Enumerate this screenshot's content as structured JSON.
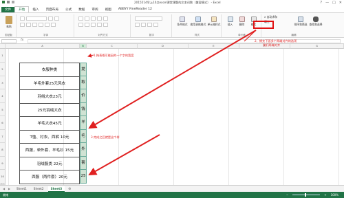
{
  "window": {
    "title": "2015514早上10点excel课堂课题的文本词数（兼容模式） - Excel",
    "controls": [
      "?",
      "—",
      "□",
      "✕"
    ]
  },
  "ribbon_tabs": [
    "文件",
    "开始",
    "插入",
    "页面布局",
    "公式",
    "数据",
    "审阅",
    "视图",
    "ABBYY FineReader 12"
  ],
  "ribbon": {
    "paste_label": "粘贴",
    "clipboard_label": "剪贴板",
    "font_label": "字体",
    "align_label": "对齐方式",
    "number_label": "数字",
    "styles_label": "样式",
    "cells_label": "单元格",
    "editing_label": "编辑",
    "cond_format": "条件格式",
    "table_format": "套用表格格式",
    "cell_styles": "单元格样式",
    "insert": "插入",
    "delete": "删除",
    "format": "格式",
    "autosum": "Σ 自动求和",
    "fill": "填充",
    "sort_filter": "排序和筛选",
    "find_select": "查找和选择"
  },
  "formula_bar": {
    "fx": "fx",
    "value": ""
  },
  "columns": [
    "A",
    "B",
    "C",
    "D",
    "E",
    "F",
    "G"
  ],
  "rows": [
    "1",
    "2",
    "3",
    "4",
    "5",
    "6",
    "7",
    "8",
    "9",
    "10",
    "11"
  ],
  "table_cells": [
    "衣服种类",
    "羊毛外套25元风衣",
    "羽绒大衣23元",
    "25元羽绒大衣",
    "羊毛大衣45元",
    "T恤、衬衣、西裤 10元",
    "西服，单外套、羊毛衫 15元",
    "羽绒服类 22元",
    "西服（两件套）20元"
  ],
  "column_b_cells": [
    "提",
    "取",
    "价",
    "钱",
    "羊",
    "毛",
    "外",
    "套",
    "25"
  ],
  "annotations": {
    "step1": "1.拖表格可能因的一个字的宽度",
    "step2_line1": "2、拥充下面多个两端对齐的选项",
    "step2_line2": "我们两端对齐",
    "step3": "3.完成之后就是这个样"
  },
  "sheet_tabs": [
    "Sheet1",
    "Sheet2",
    "Sheet3"
  ],
  "active_sheet": "Sheet3",
  "add_sheet": "⊕",
  "status": {
    "left": "就绪",
    "zoom": "100%"
  },
  "colors": {
    "excel_green": "#217346",
    "annotation_red": "#e02020"
  }
}
